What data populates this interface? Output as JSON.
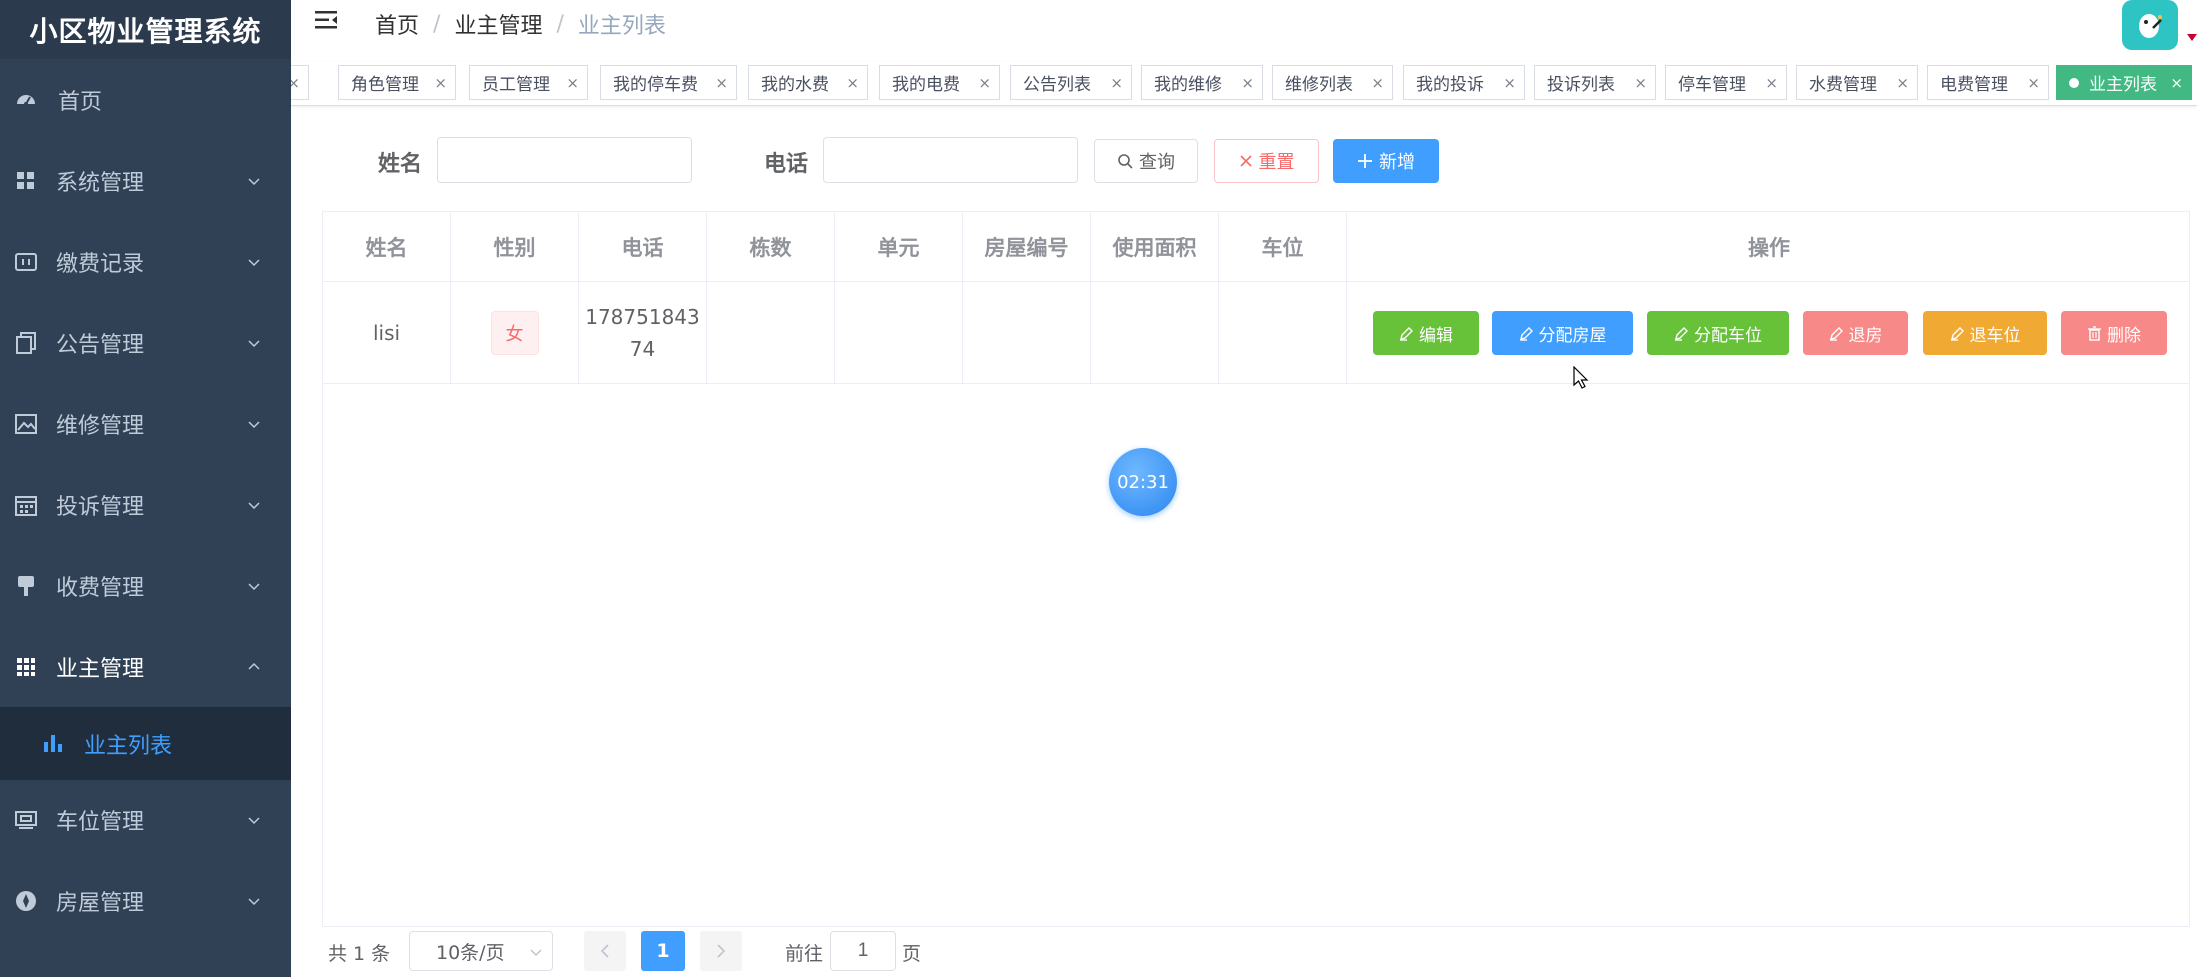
{
  "app": {
    "title": "小区物业管理系统"
  },
  "sidebar": {
    "home": "首页",
    "items": [
      {
        "label": "系统管理",
        "icon": "grid-icon"
      },
      {
        "label": "缴费记录",
        "icon": "receipt-icon"
      },
      {
        "label": "公告管理",
        "icon": "copy-icon"
      },
      {
        "label": "维修管理",
        "icon": "picture-icon"
      },
      {
        "label": "投诉管理",
        "icon": "calendar-icon"
      },
      {
        "label": "收费管理",
        "icon": "brush-icon"
      },
      {
        "label": "业主管理",
        "icon": "apps-icon"
      },
      {
        "label": "车位管理",
        "icon": "parking-icon"
      },
      {
        "label": "房屋管理",
        "icon": "compass-icon"
      }
    ],
    "submenu": {
      "label": "业主列表",
      "icon": "bar-chart-icon"
    }
  },
  "breadcrumb": [
    "首页",
    "业主管理",
    "业主列表"
  ],
  "tags": [
    "角色管理",
    "员工管理",
    "我的停车费",
    "我的水费",
    "我的电费",
    "公告列表",
    "我的维修",
    "维修列表",
    "我的投诉",
    "投诉列表",
    "停车管理",
    "水费管理",
    "电费管理"
  ],
  "active_tag": "业主列表",
  "search": {
    "name_label": "姓名",
    "name_value": "",
    "phone_label": "电话",
    "phone_value": "",
    "query_btn": "查询",
    "reset_btn": "重置",
    "add_btn": "新增"
  },
  "table": {
    "headers": [
      "姓名",
      "性别",
      "电话",
      "栋数",
      "单元",
      "房屋编号",
      "使用面积",
      "车位",
      "操作"
    ],
    "rows": [
      {
        "name": "lisi",
        "gender": "女",
        "phone": "17875184374",
        "building": "",
        "unit": "",
        "house_no": "",
        "area": "",
        "parking": ""
      }
    ],
    "actions": {
      "edit": "编辑",
      "assign_house": "分配房屋",
      "assign_parking": "分配车位",
      "checkout_house": "退房",
      "release_parking": "退车位",
      "delete": "删除"
    }
  },
  "countdown": "02:31",
  "pagination": {
    "total": "共 1 条",
    "page_size": "10条/页",
    "current": "1",
    "goto_label": "前往",
    "goto_value": "1",
    "page_suffix": "页"
  },
  "colors": {
    "sidebar_bg": "#304156",
    "active_tag": "#42b983",
    "primary": "#409eff",
    "success": "#67c23a",
    "danger": "#f78989",
    "warning": "#f0a933"
  }
}
